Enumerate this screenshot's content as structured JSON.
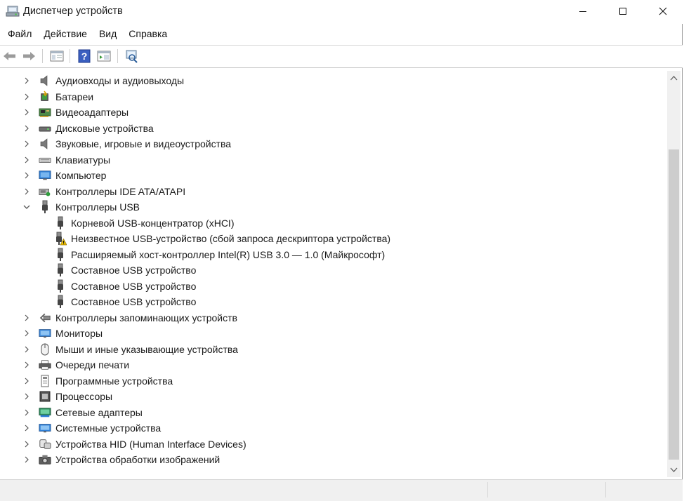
{
  "window": {
    "title": "Диспетчер устройств",
    "app_icon": "device-manager-icon"
  },
  "menu": {
    "items": [
      {
        "label": "Файл"
      },
      {
        "label": "Действие"
      },
      {
        "label": "Вид"
      },
      {
        "label": "Справка"
      }
    ]
  },
  "toolbar": {
    "buttons": [
      "back-arrow-icon",
      "forward-arrow-icon",
      "show-hide-console-tree-icon",
      "help-icon",
      "properties-icon",
      "scan-hardware-icon"
    ]
  },
  "tree": {
    "categories": [
      {
        "label": "Аудиовходы и аудиовыходы",
        "icon": "speaker-icon",
        "expanded": false
      },
      {
        "label": "Батареи",
        "icon": "battery-icon",
        "expanded": false
      },
      {
        "label": "Видеоадаптеры",
        "icon": "display-adapter-icon",
        "expanded": false
      },
      {
        "label": "Дисковые устройства",
        "icon": "disk-drive-icon",
        "expanded": false
      },
      {
        "label": "Звуковые, игровые и видеоустройства",
        "icon": "sound-device-icon",
        "expanded": false
      },
      {
        "label": "Клавиатуры",
        "icon": "keyboard-icon",
        "expanded": false
      },
      {
        "label": "Компьютер",
        "icon": "computer-icon",
        "expanded": false
      },
      {
        "label": "Контроллеры IDE ATA/ATAPI",
        "icon": "ide-controller-icon",
        "expanded": false
      },
      {
        "label": "Контроллеры USB",
        "icon": "usb-icon",
        "expanded": true,
        "children": [
          {
            "label": "Корневой USB-концентратор (xHCI)",
            "icon": "usb-icon",
            "warning": false
          },
          {
            "label": "Неизвестное USB-устройство (сбой запроса дескриптора устройства)",
            "icon": "usb-warning-icon",
            "warning": true
          },
          {
            "label": "Расширяемый хост-контроллер Intel(R) USB 3.0 — 1.0 (Майкрософт)",
            "icon": "usb-icon",
            "warning": false
          },
          {
            "label": "Составное USB устройство",
            "icon": "usb-icon",
            "warning": false
          },
          {
            "label": "Составное USB устройство",
            "icon": "usb-icon",
            "warning": false
          },
          {
            "label": "Составное USB устройство",
            "icon": "usb-icon",
            "warning": false
          }
        ]
      },
      {
        "label": "Контроллеры запоминающих устройств",
        "icon": "storage-controller-icon",
        "expanded": false
      },
      {
        "label": "Мониторы",
        "icon": "monitor-icon",
        "expanded": false
      },
      {
        "label": "Мыши и иные указывающие устройства",
        "icon": "mouse-icon",
        "expanded": false
      },
      {
        "label": "Очереди печати",
        "icon": "printer-icon",
        "expanded": false
      },
      {
        "label": "Программные устройства",
        "icon": "software-device-icon",
        "expanded": false
      },
      {
        "label": "Процессоры",
        "icon": "processor-icon",
        "expanded": false
      },
      {
        "label": "Сетевые адаптеры",
        "icon": "network-adapter-icon",
        "expanded": false
      },
      {
        "label": "Системные устройства",
        "icon": "system-device-icon",
        "expanded": false
      },
      {
        "label": "Устройства HID (Human Interface Devices)",
        "icon": "hid-icon",
        "expanded": false
      },
      {
        "label": "Устройства обработки изображений",
        "icon": "camera-icon",
        "expanded": false
      }
    ]
  },
  "colors": {
    "accent_blue": "#2f7fd6",
    "warning_yellow": "#f6c600"
  }
}
